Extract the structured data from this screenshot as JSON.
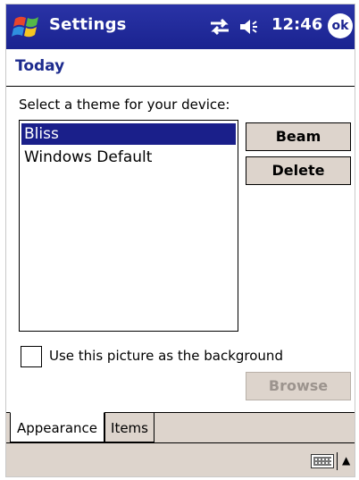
{
  "titlebar": {
    "app_title": "Settings",
    "clock": "12:46",
    "ok_label": "ok"
  },
  "page": {
    "title": "Today",
    "prompt": "Select a theme for your device:"
  },
  "themes": {
    "items": [
      {
        "label": "Bliss",
        "selected": true
      },
      {
        "label": "Windows Default",
        "selected": false
      }
    ]
  },
  "buttons": {
    "beam": "Beam",
    "delete": "Delete",
    "browse": "Browse"
  },
  "background_option": {
    "label": "Use this picture as the background",
    "checked": false
  },
  "tabs": [
    {
      "label": "Appearance",
      "active": true
    },
    {
      "label": "Items",
      "active": false
    }
  ],
  "colors": {
    "titlebar": "#1a2390",
    "selection": "#1a1f8a",
    "button_face": "#ddd4cc",
    "page_title": "#1d2b8e"
  }
}
